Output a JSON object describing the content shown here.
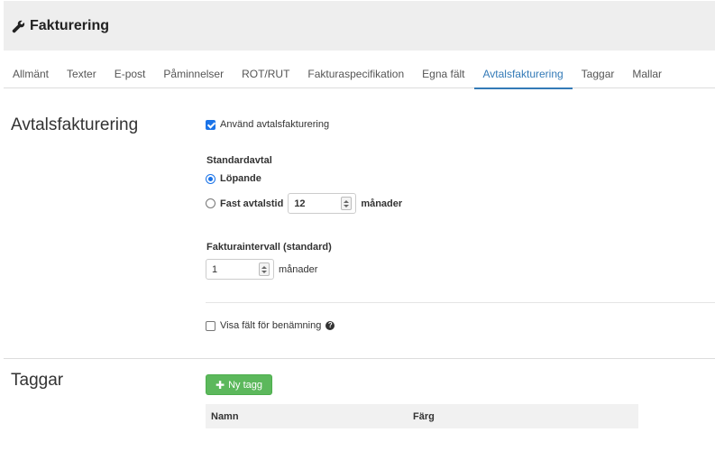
{
  "header": {
    "title": "Fakturering",
    "icon": "wrench-icon"
  },
  "tabs": [
    {
      "label": "Allmänt",
      "active": false
    },
    {
      "label": "Texter",
      "active": false
    },
    {
      "label": "E-post",
      "active": false
    },
    {
      "label": "Påminnelser",
      "active": false
    },
    {
      "label": "ROT/RUT",
      "active": false
    },
    {
      "label": "Fakturaspecifikation",
      "active": false
    },
    {
      "label": "Egna fält",
      "active": false
    },
    {
      "label": "Avtalsfakturering",
      "active": true
    },
    {
      "label": "Taggar",
      "active": false
    },
    {
      "label": "Mallar",
      "active": false
    }
  ],
  "avtal": {
    "title": "Avtalsfakturering",
    "use_label": "Använd avtalsfakturering",
    "use_checked": true,
    "standardavtal_label": "Standardavtal",
    "lopande_label": "Löpande",
    "lopande_selected": true,
    "fast_label": "Fast avtalstid",
    "fast_selected": false,
    "fast_value": "12",
    "fast_unit": "månader",
    "interval_label": "Fakturaintervall (standard)",
    "interval_value": "1",
    "interval_unit": "månader",
    "visa_label": "Visa fält för benämning",
    "visa_checked": false
  },
  "taggar": {
    "title": "Taggar",
    "new_button": "Ny tagg",
    "columns": [
      "Namn",
      "Färg"
    ]
  },
  "colors": {
    "accent": "#337ab7",
    "success": "#5cb85c",
    "header_bg": "#eeeeee"
  }
}
